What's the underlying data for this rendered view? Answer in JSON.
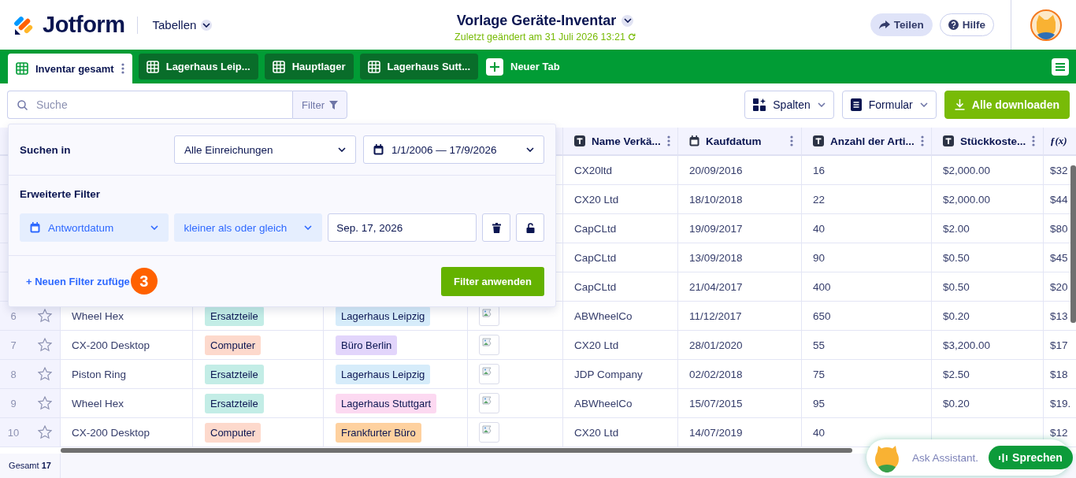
{
  "header": {
    "logo": "Jotform",
    "section": "Tabellen",
    "title": "Vorlage Geräte-Inventar",
    "subtitle": "Zuletzt geändert am 31 Juli 2026 13:21",
    "buttons": [
      {
        "kind": "share",
        "label": "Teilen"
      },
      {
        "kind": "help",
        "label": "Hilfe"
      }
    ]
  },
  "tabs": [
    {
      "label": "Inventar gesamt",
      "selected": true
    },
    {
      "label": "Lagerhaus Leip...",
      "selected": false
    },
    {
      "label": "Hauptlager",
      "selected": false
    },
    {
      "label": "Lagerhaus Sutt...",
      "selected": false
    }
  ],
  "new_tab": "Neuer Tab",
  "toolbar": {
    "search_placeholder": "Suche",
    "filter": "Filter",
    "buttons": [
      {
        "kind": "columns",
        "label": "Spalten"
      },
      {
        "kind": "form",
        "label": "Formular"
      },
      {
        "kind": "download",
        "label": "Alle downloaden"
      }
    ]
  },
  "table": {
    "columns": [
      {
        "kind": "text",
        "label": "Name Verkä..."
      },
      {
        "kind": "date",
        "label": "Kaufdatum"
      },
      {
        "kind": "text",
        "label": "Anzahl der Arti..."
      },
      {
        "kind": "text",
        "label": "Stückkoste..."
      },
      {
        "kind": "formula",
        "label": "ƒ(x)"
      }
    ],
    "rows": [
      {
        "cells": [
          "CX20ltd",
          "20/09/2016",
          "16",
          "$2,000.00",
          "$32"
        ]
      },
      {
        "cells": [
          "CX20 Ltd",
          "18/10/2018",
          "22",
          "$2,000.00",
          "$44"
        ]
      },
      {
        "cells": [
          "CapCLtd",
          "19/09/2017",
          "40",
          "$2.00",
          "$80"
        ]
      },
      {
        "cells": [
          "CapCLtd",
          "13/09/2018",
          "90",
          "$0.50",
          "$45"
        ]
      },
      {
        "cells": [
          "CapCLtd",
          "21/04/2017",
          "400",
          "$0.50",
          "$20"
        ]
      },
      {
        "number": "6",
        "starred": false,
        "name": "Wheel Hex",
        "category": {
          "label": "Ersatzteile",
          "color": "#c3ede6"
        },
        "location": {
          "label": "Lagerhaus Leipzig",
          "color": "#d6ecfa"
        },
        "image": true,
        "cells": [
          "ABWheelCo",
          "11/12/2017",
          "650",
          "$0.20",
          "$13"
        ]
      },
      {
        "number": "7",
        "starred": false,
        "name": "CX-200 Desktop",
        "category": {
          "label": "Computer",
          "color": "#fdd9cc"
        },
        "location": {
          "label": "Büro Berlin",
          "color": "#e2d5fb"
        },
        "image": true,
        "cells": [
          "CX20 Ltd",
          "28/01/2020",
          "55",
          "$3,200.00",
          "$17"
        ]
      },
      {
        "number": "8",
        "starred": false,
        "name": "Piston Ring",
        "category": {
          "label": "Ersatzteile",
          "color": "#c3ede6"
        },
        "location": {
          "label": "Lagerhaus Leipzig",
          "color": "#d6ecfa"
        },
        "image": true,
        "cells": [
          "JDP Company",
          "02/02/2018",
          "75",
          "$2.50",
          "$18"
        ]
      },
      {
        "number": "9",
        "starred": false,
        "name": "Wheel Hex",
        "category": {
          "label": "Ersatzteile",
          "color": "#c3ede6"
        },
        "location": {
          "label": "Lagerhaus Stuttgart",
          "color": "#fcd9f1"
        },
        "image": true,
        "cells": [
          "ABWheelCo",
          "15/07/2015",
          "95",
          "$0.20",
          "$19."
        ]
      },
      {
        "number": "10",
        "starred": false,
        "name": "CX-200 Desktop",
        "category": {
          "label": "Computer",
          "color": "#fdd9cc"
        },
        "location": {
          "label": "Frankfurter Büro",
          "color": "#fed19f"
        },
        "image": true,
        "cells": [
          "CX20 Ltd",
          "14/07/2019",
          "40",
          "",
          "$12"
        ]
      }
    ]
  },
  "footer": "Gesamt **17**",
  "filter_panel": {
    "search_in_label": "Suchen in",
    "scope": "Alle Einreichungen",
    "date_range": "1/1/2006 — 17/9/2026",
    "advanced_label": "Erweiterte Filter",
    "filters": [
      {
        "field": "Antwortdatum",
        "operator": "kleiner als oder gleich",
        "value": "Sep. 17, 2026"
      }
    ],
    "add_filter": "+ Neuen Filter zufüge",
    "badge": "3",
    "apply": "Filter anwenden"
  },
  "assistant": {
    "placeholder": "Ask Assistant.",
    "button": "Sprechen"
  }
}
